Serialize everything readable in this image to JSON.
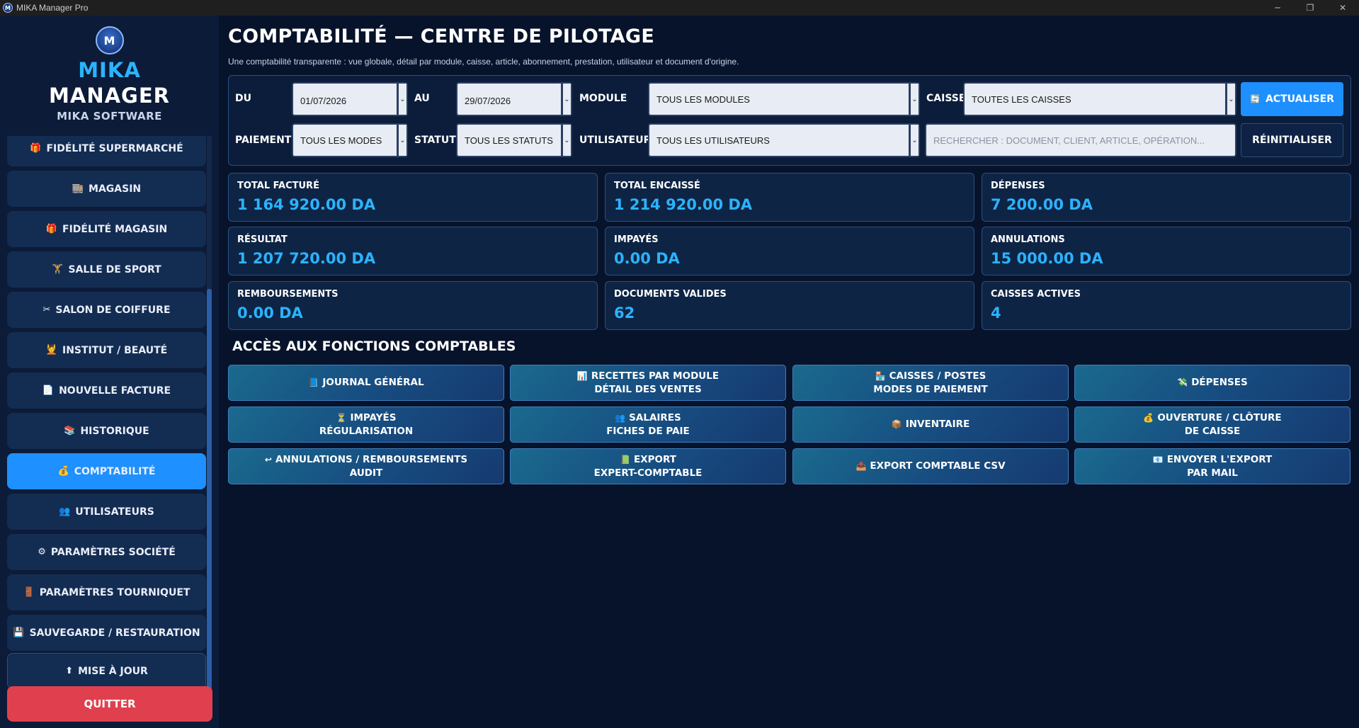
{
  "window": {
    "title": "MIKA Manager Pro",
    "icon_text": "M",
    "controls": {
      "minimize": "─",
      "maximize": "❐",
      "close": "✕"
    }
  },
  "sidebar": {
    "logo_text": "M",
    "brand_line1": "MIKA",
    "brand_line2": "MANAGER",
    "brand_line3": "MIKA SOFTWARE",
    "items": [
      {
        "icon": "🎁",
        "label": "FIDÉLITÉ SUPERMARCHÉ"
      },
      {
        "icon": "🏬",
        "label": "MAGASIN"
      },
      {
        "icon": "🎁",
        "label": "FIDÉLITÉ MAGASIN"
      },
      {
        "icon": "🏋",
        "label": "SALLE DE SPORT"
      },
      {
        "icon": "✂",
        "label": "SALON DE COIFFURE"
      },
      {
        "icon": "💆",
        "label": "INSTITUT / BEAUTÉ"
      },
      {
        "icon": "📄",
        "label": "NOUVELLE FACTURE"
      },
      {
        "icon": "📚",
        "label": "HISTORIQUE"
      },
      {
        "icon": "💰",
        "label": "COMPTABILITÉ"
      },
      {
        "icon": "👥",
        "label": "UTILISATEURS"
      },
      {
        "icon": "⚙",
        "label": "PARAMÈTRES SOCIÉTÉ"
      },
      {
        "icon": "🚪",
        "label": "PARAMÈTRES TOURNIQUET"
      },
      {
        "icon": "💾",
        "label": "SAUVEGARDE / RESTAURATION"
      },
      {
        "icon": "⬆",
        "label": "MISE À JOUR"
      }
    ],
    "active_item": "COMPTABILITÉ",
    "quit_label": "QUITTER"
  },
  "header": {
    "title": "COMPTABILITÉ — CENTRE DE PILOTAGE",
    "subtitle": "Une comptabilité transparente : vue globale, détail par module, caisse, article, abonnement, prestation, utilisateur et document d'origine."
  },
  "filters": {
    "du_label": "DU",
    "du_value": "01/07/2026",
    "au_label": "AU",
    "au_value": "29/07/2026",
    "module_label": "MODULE",
    "module_value": "TOUS LES MODULES",
    "caisse_label": "CAISSE",
    "caisse_value": "TOUTES LES CAISSES",
    "refresh_icon": "🔄",
    "refresh_label": "ACTUALISER",
    "paiement_label": "PAIEMENT",
    "paiement_value": "TOUS LES MODES",
    "statut_label": "STATUT",
    "statut_value": "TOUS LES STATUTS",
    "utilisateur_label": "UTILISATEUR",
    "utilisateur_value": "TOUS LES UTILISATEURS",
    "search_placeholder": "RECHERCHER : DOCUMENT, CLIENT, ARTICLE, OPÉRATION...",
    "reset_label": "RÉINITIALISER",
    "dropdown_arrow": "⌄"
  },
  "kpis": [
    {
      "label": "TOTAL FACTURÉ",
      "value": "1 164 920.00 DA"
    },
    {
      "label": "TOTAL ENCAISSÉ",
      "value": "1 214 920.00 DA"
    },
    {
      "label": "DÉPENSES",
      "value": "7 200.00 DA"
    },
    {
      "label": "RÉSULTAT",
      "value": "1 207 720.00 DA"
    },
    {
      "label": "IMPAYÉS",
      "value": "0.00 DA"
    },
    {
      "label": "ANNULATIONS",
      "value": "15 000.00 DA"
    },
    {
      "label": "REMBOURSEMENTS",
      "value": "0.00 DA"
    },
    {
      "label": "DOCUMENTS VALIDES",
      "value": "62"
    },
    {
      "label": "CAISSES ACTIVES",
      "value": "4"
    }
  ],
  "functions": {
    "section_title": "ACCÈS AUX FONCTIONS COMPTABLES",
    "buttons": [
      {
        "icon": "📘",
        "line1": "JOURNAL GÉNÉRAL",
        "line2": ""
      },
      {
        "icon": "📊",
        "line1": "RECETTES PAR MODULE",
        "line2": "DÉTAIL DES VENTES"
      },
      {
        "icon": "🏪",
        "line1": "CAISSES / POSTES",
        "line2": "MODES DE PAIEMENT"
      },
      {
        "icon": "💸",
        "line1": "DÉPENSES",
        "line2": ""
      },
      {
        "icon": "⏳",
        "line1": "IMPAYÉS",
        "line2": "RÉGULARISATION"
      },
      {
        "icon": "👥",
        "line1": "SALAIRES",
        "line2": "FICHES DE PAIE"
      },
      {
        "icon": "📦",
        "line1": "INVENTAIRE",
        "line2": ""
      },
      {
        "icon": "💰",
        "line1": "OUVERTURE / CLÔTURE",
        "line2": "DE CAISSE"
      },
      {
        "icon": "↩",
        "line1": "ANNULATIONS / REMBOURSEMENTS",
        "line2": "AUDIT"
      },
      {
        "icon": "📗",
        "line1": "EXPORT",
        "line2": "EXPERT-COMPTABLE"
      },
      {
        "icon": "📤",
        "line1": "EXPORT COMPTABLE CSV",
        "line2": ""
      },
      {
        "icon": "📧",
        "line1": "ENVOYER L'EXPORT",
        "line2": "PAR MAIL"
      }
    ]
  }
}
